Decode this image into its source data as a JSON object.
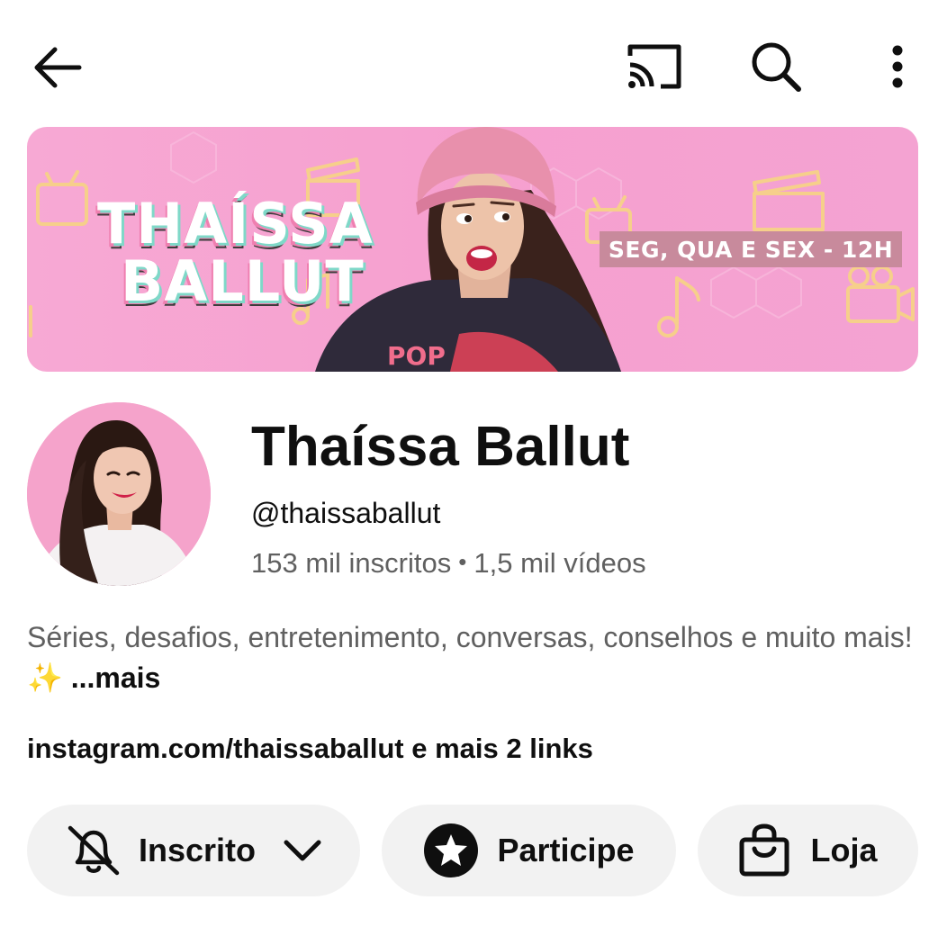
{
  "topbar": {
    "back_icon": "arrow-left-icon",
    "cast_icon": "cast-icon",
    "search_icon": "search-icon",
    "more_icon": "more-vertical-icon"
  },
  "banner": {
    "name_line1": "THAÍSSA",
    "name_line2": "BALLUT",
    "schedule": "SEG, QUA E SEX - 12H",
    "shirt_text": "POP"
  },
  "channel": {
    "name": "Thaíssa Ballut",
    "handle": "@thaissaballut",
    "subscribers": "153 mil inscritos",
    "separator": "•",
    "videos": "1,5 mil vídeos"
  },
  "description": {
    "text": "Séries, desafios, entretenimento, conversas, conselhos e muito mais! ✨ ",
    "more_label": "...mais"
  },
  "links": {
    "text": "instagram.com/thaissaballut e mais 2 links"
  },
  "actions": {
    "subscribe_label": "Inscrito",
    "join_label": "Participe",
    "store_label": "Loja"
  },
  "colors": {
    "banner_pink": "#f6a0cf",
    "pill_bg": "#f2f2f2",
    "secondary_text": "#606060",
    "primary_text": "#0f0f0f"
  }
}
